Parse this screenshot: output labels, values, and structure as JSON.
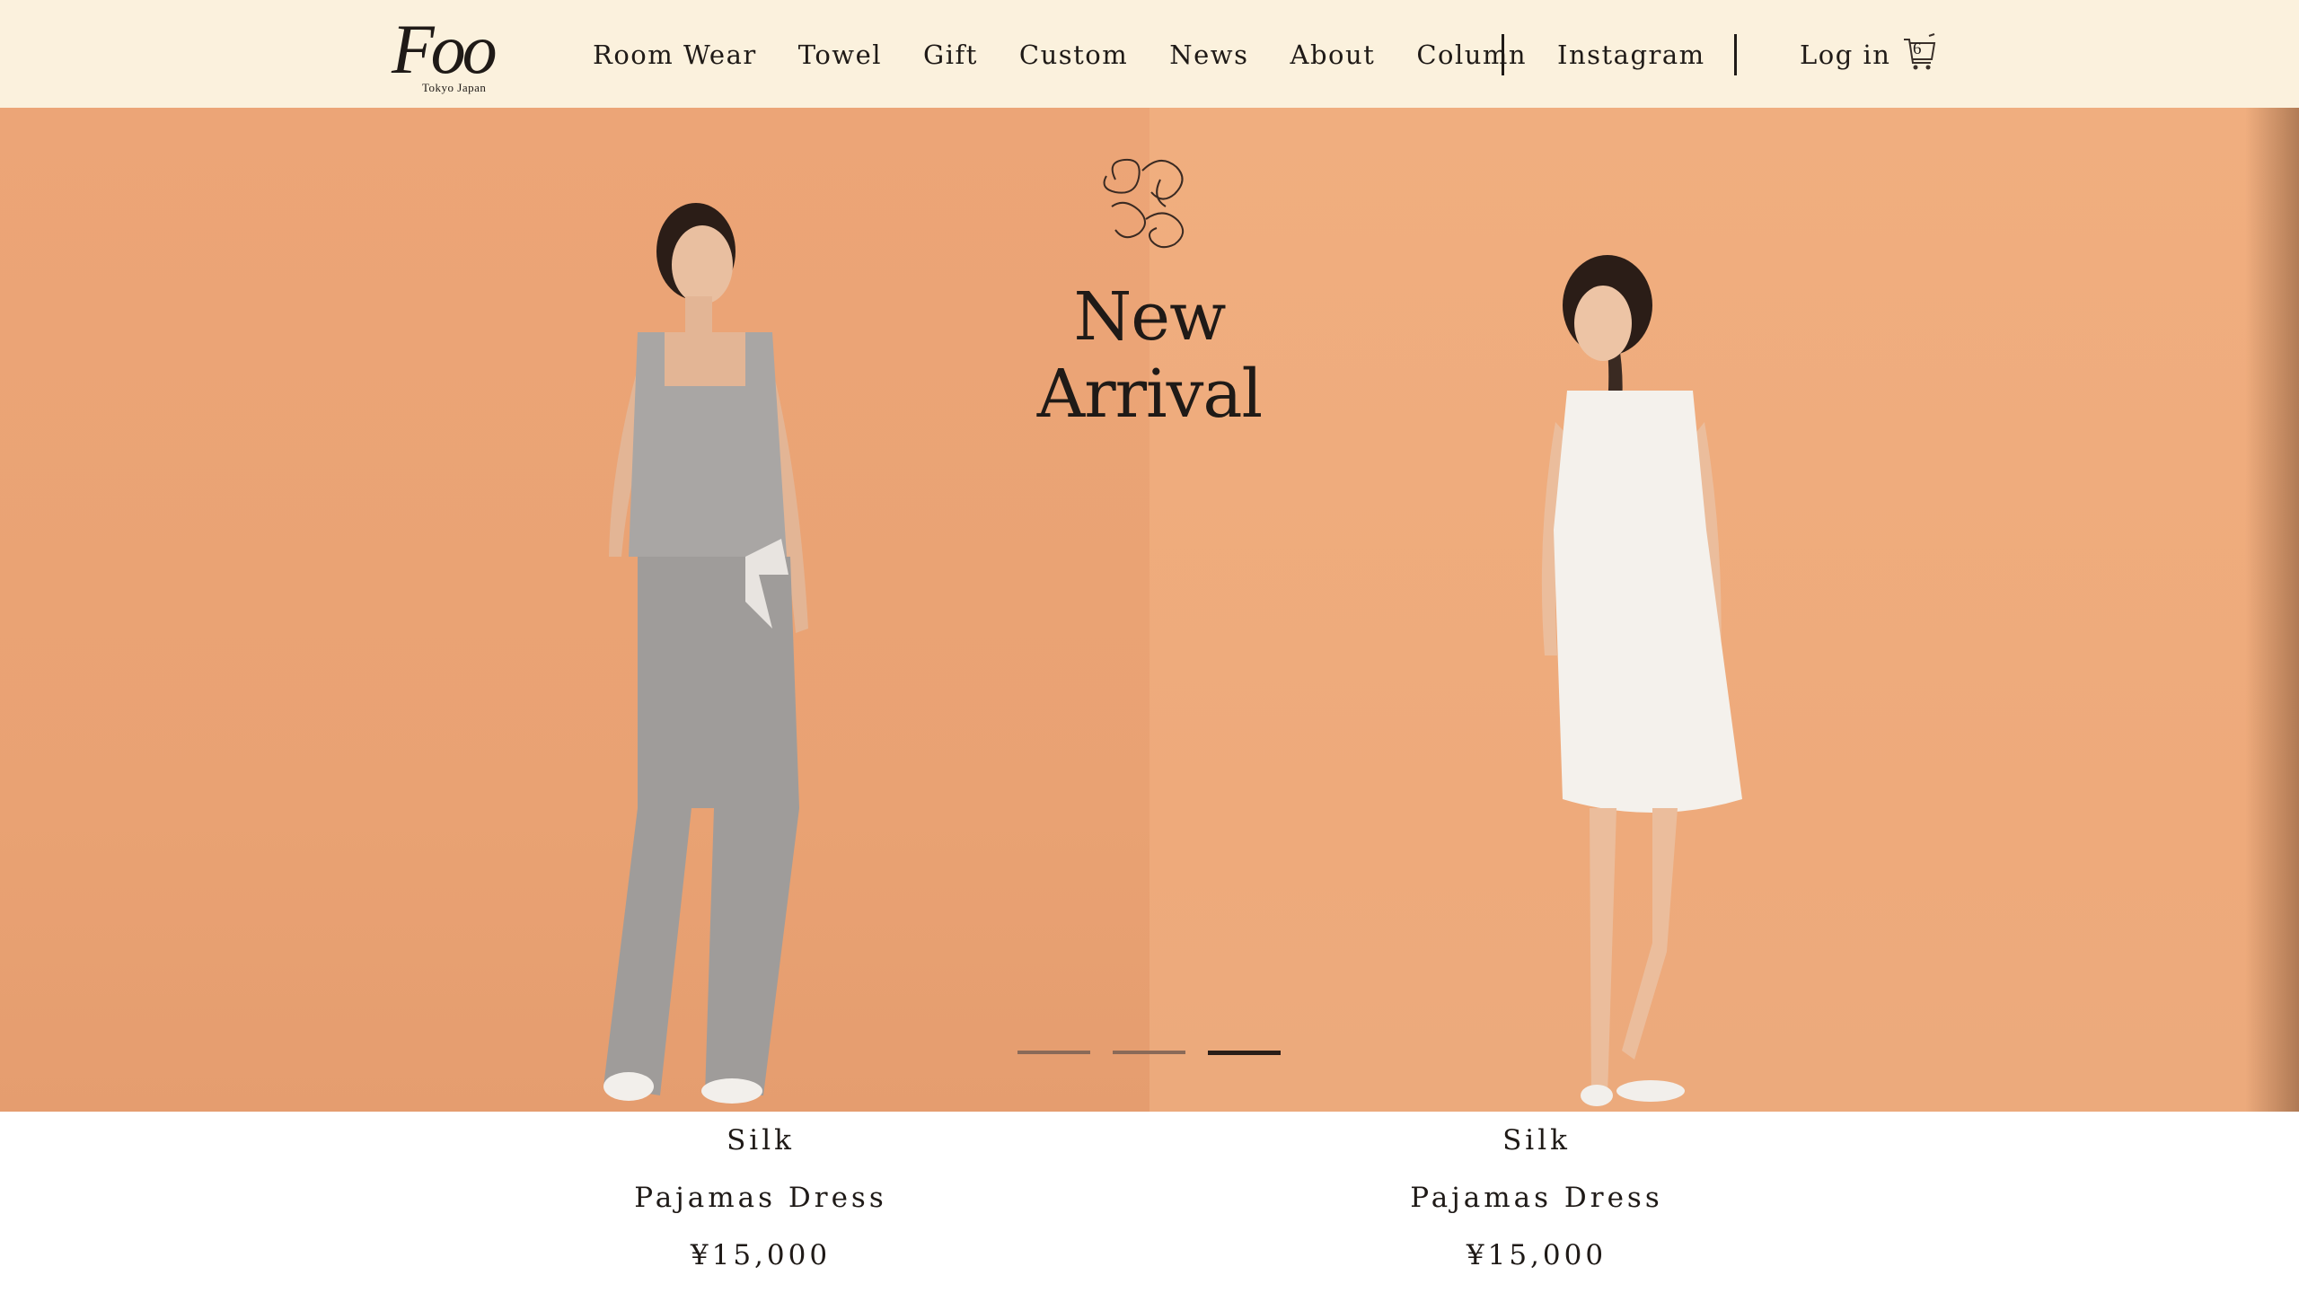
{
  "brand": {
    "logo_text": "Foo",
    "logo_subtitle": "Tokyo Japan"
  },
  "nav": {
    "items": [
      "Room Wear",
      "Towel",
      "Gift",
      "Custom",
      "News",
      "About",
      "Column"
    ],
    "instagram": "Instagram",
    "login": "Log in",
    "cart_count": "6"
  },
  "hero": {
    "title": "New Arrival",
    "slides_total": 3,
    "active_slide": 3
  },
  "products": [
    {
      "material": "Silk",
      "name": "Pajamas Dress",
      "price": "¥15,000"
    },
    {
      "material": "Silk",
      "name": "Pajamas Dress",
      "price": "¥15,000"
    }
  ],
  "colors": {
    "header_bg": "#fbf1dd",
    "hero_bg": "#eba77a",
    "text": "#1f1a17"
  }
}
